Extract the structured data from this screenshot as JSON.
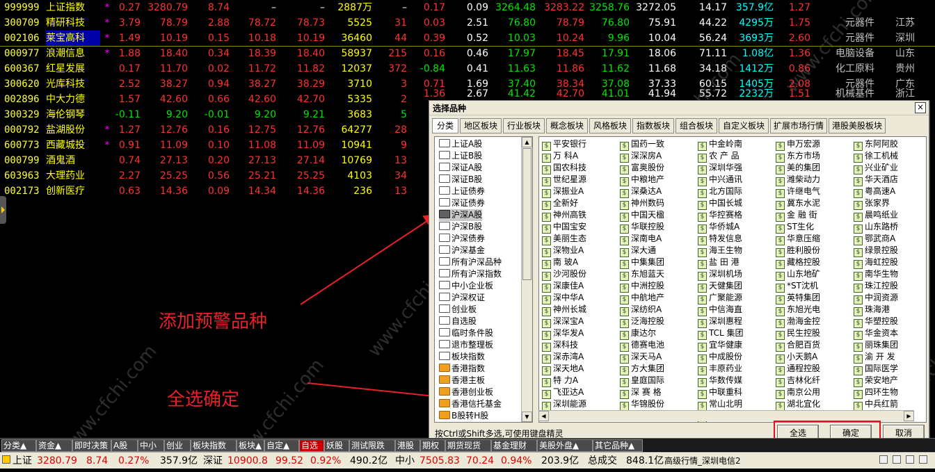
{
  "quotes": [
    {
      "code": "999999",
      "name": "上证指数",
      "mark": "*",
      "pct": "0.27",
      "price": "3280.79",
      "chg": "8.74",
      "buy": "–",
      "sell": "–",
      "vol": "2887万",
      "cur": "–",
      "spd": "0.17",
      "turn": "0.09",
      "open": "3264.48",
      "high": "3283.22",
      "low": "3258.76",
      "prev": "3272.05",
      "pe": "14.17",
      "amt": "357.9亿",
      "vr": "1.27",
      "ind": "",
      "area": ""
    },
    {
      "code": "300709",
      "name": "精研科技",
      "mark": "*",
      "pct": "3.79",
      "price": "78.79",
      "chg": "2.88",
      "buy": "78.72",
      "sell": "78.73",
      "vol": "5525",
      "cur": "31",
      "spd": "0.03",
      "turn": "2.51",
      "open": "76.80",
      "high": "78.79",
      "low": "76.80",
      "prev": "75.91",
      "pe": "44.22",
      "amt": "4295万",
      "vr": "1.75",
      "ind": "元器件",
      "area": "江苏"
    },
    {
      "code": "002106",
      "name": "莱宝高科",
      "mark": "*",
      "pct": "1.49",
      "price": "10.19",
      "chg": "0.15",
      "buy": "10.18",
      "sell": "10.19",
      "vol": "36460",
      "cur": "44",
      "spd": "0.39",
      "turn": "0.52",
      "open": "10.03",
      "high": "10.24",
      "low": "9.96",
      "prev": "10.04",
      "pe": "56.24",
      "amt": "3693万",
      "vr": "2.60",
      "ind": "元器件",
      "area": "深圳"
    },
    {
      "code": "000977",
      "name": "浪潮信息",
      "mark": "*",
      "pct": "1.88",
      "price": "18.40",
      "chg": "0.34",
      "buy": "18.39",
      "sell": "18.40",
      "vol": "58937",
      "cur": "215",
      "spd": "0.16",
      "turn": "0.46",
      "open": "17.97",
      "high": "18.45",
      "low": "17.91",
      "prev": "18.06",
      "pe": "71.11",
      "amt": "1.08亿",
      "vr": "1.36",
      "ind": "电脑设备",
      "area": "山东"
    },
    {
      "code": "600367",
      "name": "红星发展",
      "mark": "",
      "pct": "0.17",
      "price": "11.70",
      "chg": "0.02",
      "buy": "11.72",
      "sell": "11.82",
      "vol": "12037",
      "cur": "372",
      "spd": "-0.84",
      "turn": "0.41",
      "open": "11.63",
      "high": "11.86",
      "low": "11.62",
      "prev": "11.68",
      "pe": "34.18",
      "amt": "1412万",
      "vr": "0.86",
      "ind": "化工原料",
      "area": "贵州"
    },
    {
      "code": "300620",
      "name": "光库科技",
      "mark": "",
      "pct": "2.52",
      "price": "38.27",
      "chg": "0.94",
      "buy": "38.27",
      "sell": "38.29",
      "vol": "3710",
      "cur": "3",
      "spd": "0.71",
      "turn": "1.69",
      "open": "37.40",
      "high": "38.34",
      "low": "37.08",
      "prev": "37.33",
      "pe": "60.15",
      "amt": "1405万",
      "vr": "2.08",
      "ind": "元器件",
      "area": "广东"
    },
    {
      "code": "002896",
      "name": "中大力德",
      "mark": "",
      "pct": "1.57",
      "price": "42.60",
      "chg": "0.66",
      "buy": "42.60",
      "sell": "42.70",
      "vol": "5335",
      "cur": "2",
      "spd": "",
      "turn": "",
      "open": "",
      "high": "",
      "low": "",
      "prev": "",
      "pe": "",
      "amt": "",
      "vr": "",
      "ind": "",
      "area": ""
    },
    {
      "code": "300329",
      "name": "海伦钢琴",
      "mark": "",
      "pct": "-0.11",
      "price": "9.20",
      "chg": "-0.01",
      "buy": "9.20",
      "sell": "9.21",
      "vol": "3683",
      "cur": "5",
      "spd": "",
      "turn": "",
      "open": "",
      "high": "",
      "low": "",
      "prev": "",
      "pe": "",
      "amt": "",
      "vr": "",
      "ind": "",
      "area": ""
    },
    {
      "code": "000792",
      "name": "盐湖股份",
      "mark": "*",
      "pct": "1.27",
      "price": "12.76",
      "chg": "0.16",
      "buy": "12.75",
      "sell": "12.76",
      "vol": "64277",
      "cur": "28",
      "spd": "",
      "turn": "",
      "open": "",
      "high": "",
      "low": "",
      "prev": "",
      "pe": "",
      "amt": "",
      "vr": "",
      "ind": "",
      "area": ""
    },
    {
      "code": "600773",
      "name": "西藏城投",
      "mark": "*",
      "pct": "0.91",
      "price": "11.09",
      "chg": "0.10",
      "buy": "11.08",
      "sell": "11.09",
      "vol": "10941",
      "cur": "9",
      "spd": "",
      "turn": "",
      "open": "",
      "high": "",
      "low": "",
      "prev": "",
      "pe": "",
      "amt": "",
      "vr": "",
      "ind": "",
      "area": ""
    },
    {
      "code": "000799",
      "name": "酒鬼酒",
      "mark": "",
      "pct": "0.74",
      "price": "27.13",
      "chg": "0.20",
      "buy": "27.13",
      "sell": "27.14",
      "vol": "10769",
      "cur": "13",
      "spd": "",
      "turn": "",
      "open": "",
      "high": "",
      "low": "",
      "prev": "",
      "pe": "",
      "amt": "",
      "vr": "",
      "ind": "",
      "area": ""
    },
    {
      "code": "603963",
      "name": "大理药业",
      "mark": "",
      "pct": "2.27",
      "price": "25.25",
      "chg": "0.56",
      "buy": "25.21",
      "sell": "25.25",
      "vol": "4103",
      "cur": "34",
      "spd": "",
      "turn": "",
      "open": "",
      "high": "",
      "low": "",
      "prev": "",
      "pe": "",
      "amt": "",
      "vr": "",
      "ind": "",
      "area": ""
    },
    {
      "code": "002173",
      "name": "创新医疗",
      "mark": "",
      "pct": "0.63",
      "price": "14.36",
      "chg": "0.09",
      "buy": "14.34",
      "sell": "14.36",
      "vol": "236",
      "cur": "13",
      "spd": "",
      "turn": "",
      "open": "",
      "high": "",
      "low": "",
      "prev": "",
      "pe": "",
      "amt": "",
      "vr": "",
      "ind": "",
      "area": ""
    }
  ],
  "partial_row": {
    "spd": "1.36",
    "turn": "2.67",
    "open": "41.42",
    "high": "42.70",
    "low": "41.01",
    "prev": "41.94",
    "pe": "55.72",
    "amt": "2232万",
    "vr": "1.51",
    "ind": "机械基件",
    "area": "浙江"
  },
  "annotations": {
    "add": "添加预警品种",
    "selectall": "全选确定"
  },
  "watermark": "www.cfchi.com",
  "dialog": {
    "title": "选择品种",
    "close": "×",
    "tabs": [
      "分类",
      "地区板块",
      "行业板块",
      "概念板块",
      "风格板块",
      "指数板块",
      "组合板块",
      "自定义板块",
      "扩展市场行情",
      "港股美股板块"
    ],
    "tree": [
      "上证A股",
      "上证B股",
      "深证A股",
      "深证B股",
      "上证债券",
      "深证债券",
      "沪深A股",
      "沪深B股",
      "沪深债券",
      "沪深基金",
      "所有沪深品种",
      "所有沪深指数",
      "中小企业板",
      "沪深权证",
      "创业板",
      "自选股",
      "临时条件股",
      "退市整理板",
      "板块指数",
      "香港指数",
      "香港主板",
      "香港创业板",
      "香港信托基金",
      "B股转H股"
    ],
    "selected_tree": "沪深A股",
    "grid": [
      [
        "平安银行",
        "万 科A",
        "国农科技",
        "世纪星源",
        "深振业A",
        "全新好",
        "神州高铁",
        "中国宝安",
        "美丽生态",
        "深物业A",
        "南 玻A",
        "沙河股份",
        "深康佳A",
        "深中华A",
        "神州长城",
        "深深宝A",
        "深华发A",
        "深科技",
        "深赤湾A",
        "深天地A",
        "特 力A",
        "飞亚达A",
        "深圳能源"
      ],
      [
        "国药一致",
        "深深房A",
        "富奥股份",
        "中粮地产",
        "深桑达A",
        "神州数码",
        "中国天楹",
        "华联控股",
        "深南电A",
        "深大通",
        "中集集团",
        "东旭蓝天",
        "中洲控股",
        "中航地产",
        "深纺织A",
        "泛海控股",
        "康达尔",
        "德赛电池",
        "深天马A",
        "方大集团",
        "皇庭国际",
        "深 赛 格",
        "华锦股份"
      ],
      [
        "中金岭南",
        "农 产 品",
        "深圳华强",
        "中兴通讯",
        "北方国际",
        "中国长城",
        "华控赛格",
        "华侨城A",
        "特发信息",
        "海王生物",
        "盐 田 港",
        "深圳机场",
        "天健集团",
        "广聚能源",
        "中信海直",
        "深圳惠程",
        "TCL 集团",
        "宜华健康",
        "中成股份",
        "丰原药业",
        "华数传媒",
        "中联重科",
        "常山北明",
        "国际实业"
      ],
      [
        "申万宏源",
        "东方市场",
        "美的集团",
        "潍柴动力",
        "许继电气",
        "冀东水泥",
        "金 融 街",
        "ST生化",
        "华意压缩",
        "胜利股份",
        "藏格控股",
        "山东地矿",
        "*ST沈机",
        "英特集团",
        "东旭光电",
        "渤海金控",
        "民生控股",
        "合肥百货",
        "小天鹅A",
        "通程控股",
        "吉林化纤",
        "南京公用",
        "湖北宜化"
      ],
      [
        "东阿阿胶",
        "徐工机械",
        "兴业矿业",
        "华天酒店",
        "粤高速A",
        "张家界",
        "晨鸣纸业",
        "山东路桥",
        "鄂武商A",
        "绿景控股",
        "海虹控股",
        "南华生物",
        "珠江控股",
        "中润资源",
        "珠海港",
        "华塑控股",
        "华金资本",
        "丽珠集团",
        "渝 开 发",
        "国际医学",
        "荣安地产",
        "四环生物",
        "中兵红箭"
      ]
    ],
    "hint": "按Ctrl或Shift多选,可使用键盘精灵",
    "btn_selectall": "全选",
    "btn_ok": "确定",
    "btn_cancel": "取消"
  },
  "bottom_tabs": [
    "分类▲",
    "资金▲",
    "即时决策",
    "A股",
    "中小",
    "创业",
    "板块指数",
    "板块▲",
    "自定▲",
    "自选",
    "妖股",
    "测试限跌",
    "港股",
    "期权",
    "期货现货",
    "基金理财",
    "美股外盘▲",
    "其它品种▲"
  ],
  "active_bottom_tab": "自选",
  "status": {
    "sh_label": "上证",
    "sh_val": "3280.79",
    "sh_chg": "8.74",
    "sh_pct": "0.27%",
    "sh_amt": "357.9亿",
    "sz_label": "深证",
    "sz_val": "10900.8",
    "sz_chg": "99.52",
    "sz_pct": "0.92%",
    "sz_amt": "490.2亿",
    "zx_label": "中小",
    "zx_val": "7505.83",
    "zx_chg": "70.24",
    "zx_pct": "0.94%",
    "zx_amt": "203.9亿",
    "total_label": "总成交",
    "total_val": "848.1亿",
    "server": "高级行情_深圳电信2"
  },
  "colors": {
    "up": "#ff3232",
    "down": "#00e600",
    "code": "#ffff33",
    "amount": "#00ffff",
    "annotation": "#e8202a",
    "dialog_bg": "#ece9d8"
  }
}
